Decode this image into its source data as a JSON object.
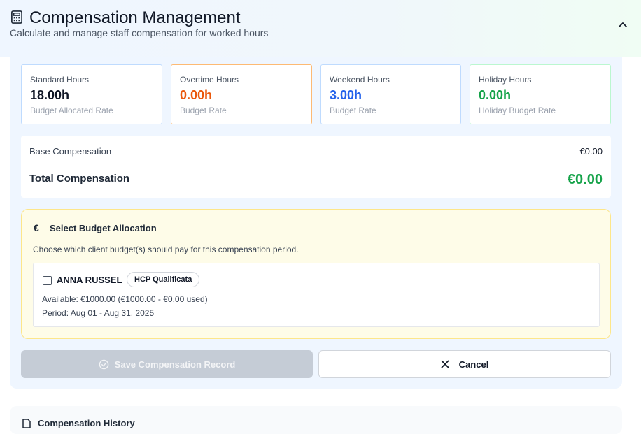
{
  "header": {
    "icon": "calculator-icon",
    "title": "Compensation Management",
    "subtitle": "Calculate and manage staff compensation for worked hours",
    "collapse_icon": "chevron-up-icon"
  },
  "stats": [
    {
      "label": "Standard Hours",
      "value": "18.00h",
      "sub": "Budget Allocated Rate",
      "color": "#111827"
    },
    {
      "label": "Overtime Hours",
      "value": "0.00h",
      "sub": "Budget Rate",
      "color": "#ea580c"
    },
    {
      "label": "Weekend Hours",
      "value": "3.00h",
      "sub": "Budget Rate",
      "color": "#2563eb"
    },
    {
      "label": "Holiday Hours",
      "value": "0.00h",
      "sub": "Holiday Budget Rate",
      "color": "#16a34a"
    }
  ],
  "summary": {
    "base_label": "Base Compensation",
    "base_value": "€0.00",
    "total_label": "Total Compensation",
    "total_value": "€0.00"
  },
  "budget": {
    "icon": "euro-icon",
    "euro_symbol": "€",
    "title": "Select Budget Allocation",
    "description": "Choose which client budget(s) should pay for this compensation period.",
    "client": {
      "checked": false,
      "name": "ANNA RUSSEL",
      "badge": "HCP Qualificata",
      "available": "Available: €1000.00 (€1000.00 - €0.00 used)",
      "period": "Period: Aug 01 - Aug 31, 2025"
    }
  },
  "actions": {
    "save_label": "Save Compensation Record",
    "save_icon": "check-circle-icon",
    "save_disabled": true,
    "cancel_label": "Cancel",
    "cancel_icon": "close-icon"
  },
  "history": {
    "icon": "document-icon",
    "title": "Compensation History"
  }
}
